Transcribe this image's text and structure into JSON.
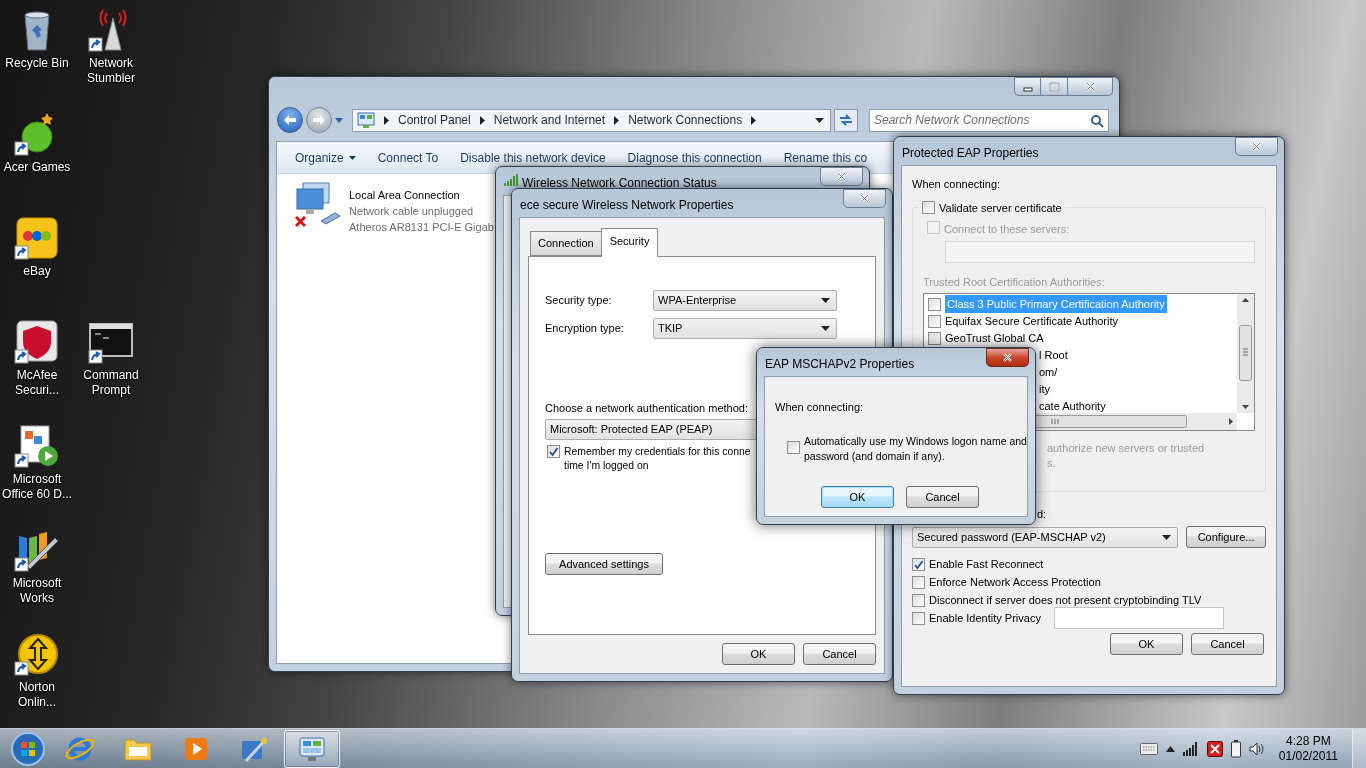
{
  "desktop_icon_rows": [
    [
      {
        "label": "Recycle Bin",
        "kind": "recycle-bin"
      },
      {
        "label": "Network Stumbler",
        "kind": "antenna"
      }
    ],
    [
      {
        "label": "Acer Games",
        "kind": "games"
      }
    ],
    [
      {
        "label": "eBay",
        "kind": "shop"
      }
    ],
    [
      {
        "label": "McAfee Securi...",
        "kind": "shield"
      },
      {
        "label": "Command Prompt",
        "kind": "console"
      }
    ],
    [
      {
        "label": "Microsoft Office 60 D...",
        "kind": "office"
      }
    ],
    [
      {
        "label": "Microsoft Works",
        "kind": "works"
      }
    ],
    [
      {
        "label": "Norton Onlin...",
        "kind": "backup"
      }
    ]
  ],
  "explorer": {
    "breadcrumb": [
      "Control Panel",
      "Network and Internet",
      "Network Connections"
    ],
    "search": {
      "placeholder": "Search Network Connections"
    },
    "toolbar": [
      {
        "label": "Organize",
        "kind": "menu"
      },
      {
        "label": "Connect To",
        "kind": "command"
      },
      {
        "label": "Disable this network device",
        "kind": "command"
      },
      {
        "label": "Diagnose this connection",
        "kind": "command"
      },
      {
        "label": "Rename this co",
        "kind": "command"
      }
    ],
    "connections": [
      {
        "name": "Local Area Connection",
        "status": "Network cable unplugged",
        "device": "Atheros AR8131 PCI-E Gigab",
        "connected": false
      }
    ]
  },
  "status_window": {
    "title": "Wireless Network Connection Status"
  },
  "properties_window": {
    "title": "ece secure Wireless Network Properties",
    "tabs": [
      {
        "label": "Connection",
        "selected": false
      },
      {
        "label": "Security",
        "selected": true
      }
    ],
    "fields": [
      {
        "label": "Security type:",
        "value": "WPA-Enterprise"
      },
      {
        "label": "Encryption type:",
        "value": "TKIP"
      }
    ],
    "auth_label": "Choose a network authentication method:",
    "auth_method": "Microsoft: Protected EAP (PEAP)",
    "remember": {
      "lines": [
        "Remember my credentials for this conne",
        "time I'm logged on"
      ],
      "checked": true
    },
    "advanced_button": "Advanced settings",
    "buttons": [
      "OK",
      "Cancel"
    ]
  },
  "peap_window": {
    "title": "Protected EAP Properties",
    "when_connecting": "When connecting:",
    "validate": {
      "label": "Validate server certificate",
      "checked": false
    },
    "connect_servers": {
      "label": "Connect to these servers:",
      "checked": false
    },
    "trusted_label": "Trusted Root Certification Authorities:",
    "authorities": [
      {
        "text": "Class 3 Public Primary Certification Authority",
        "kind": "full",
        "checked": false,
        "selected": true
      },
      {
        "text": "Equifax Secure Certificate Authority",
        "kind": "full",
        "checked": false,
        "selected": false
      },
      {
        "text": "GeoTrust Global CA",
        "kind": "full",
        "checked": false,
        "selected": false
      },
      {
        "text": "l Root",
        "kind": "clipped",
        "selected": false
      },
      {
        "text": "om/",
        "kind": "clipped",
        "selected": false
      },
      {
        "text": "ity",
        "kind": "clipped",
        "selected": false
      },
      {
        "text": "cate Authority",
        "kind": "clipped",
        "selected": false
      }
    ],
    "hint_lines": [
      "authorize new servers or trusted",
      "s."
    ],
    "method_label": "d:",
    "method": "Secured password (EAP-MSCHAP v2)",
    "configure_button": "Configure...",
    "options": [
      {
        "label": "Enable Fast Reconnect",
        "checked": true,
        "kind": "plain"
      },
      {
        "label": "Enforce Network Access Protection",
        "checked": false,
        "kind": "plain"
      },
      {
        "label": "Disconnect if server does not present cryptobinding TLV",
        "checked": false,
        "kind": "plain"
      },
      {
        "label": "Enable Identity Privacy",
        "checked": false,
        "kind": "with-field"
      }
    ],
    "buttons": [
      "OK",
      "Cancel"
    ]
  },
  "mschap_dialog": {
    "title": "EAP MSCHAPv2 Properties",
    "when_connecting": "When connecting:",
    "auto_logon": {
      "lines": [
        "Automatically use my Windows logon name and",
        "password (and domain if any)."
      ],
      "checked": false
    },
    "buttons": [
      {
        "label": "OK",
        "default": true
      },
      {
        "label": "Cancel",
        "default": false
      }
    ]
  },
  "taskbar": {
    "apps": [
      {
        "kind": "browser",
        "active": false
      },
      {
        "kind": "folder",
        "active": false
      },
      {
        "kind": "media",
        "active": false
      },
      {
        "kind": "tool",
        "active": false
      },
      {
        "kind": "control-panel",
        "active": true
      }
    ],
    "clock": {
      "time": "4:28 PM",
      "date": "01/02/2011"
    }
  }
}
